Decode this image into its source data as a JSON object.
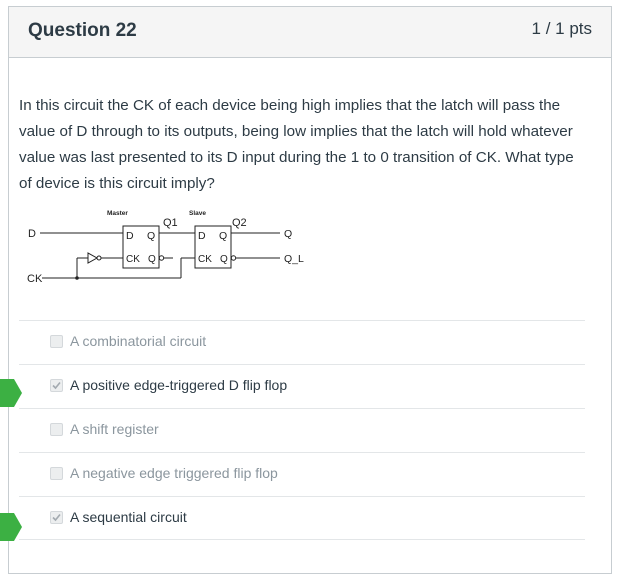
{
  "question": {
    "title": "Question 22",
    "points": "1 / 1 pts",
    "prompt": "In this  circuit the CK of each device being high implies that the latch will pass the value of D through to its outputs, being low implies that the latch will hold whatever value was last presented to its D input during the 1 to 0 transition of CK.   What type of device  is this circuit imply?"
  },
  "diagram": {
    "master_label": "Master",
    "slave_label": "Slave",
    "q1_label": "Q1",
    "q2_label": "Q2",
    "d_input": "D",
    "ck_input": "CK",
    "q_output": "Q",
    "ql_output": "Q_L",
    "latch_d": "D",
    "latch_q": "Q",
    "latch_ck": "CK",
    "latch_q2": "Q"
  },
  "answers": [
    {
      "label": "A combinatorial circuit",
      "checked": false,
      "correct_marker": false
    },
    {
      "label": "A positive edge-triggered D flip flop",
      "checked": true,
      "correct_marker": true
    },
    {
      "label": "A shift register",
      "checked": false,
      "correct_marker": false
    },
    {
      "label": "A negative edge triggered flip flop",
      "checked": false,
      "correct_marker": false
    },
    {
      "label": "A sequential circuit",
      "checked": true,
      "correct_marker": true
    }
  ],
  "colors": {
    "correct_marker": "#3cb043",
    "border": "#c7cdd1",
    "header_bg": "#f5f5f5"
  }
}
